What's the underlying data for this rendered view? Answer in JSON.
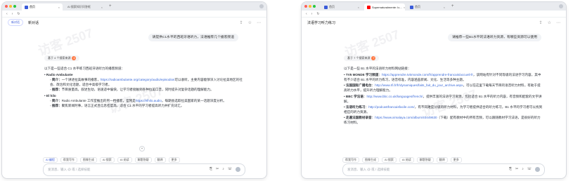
{
  "left": {
    "tabs": [
      {
        "label": "首页",
        "active": true
      },
      {
        "label": "AI 搜索知识问答框",
        "active": false
      }
    ],
    "header": {
      "new_chat": "新对话",
      "title": "新对话"
    },
    "user_message": "请提供C1水平的西班牙语听力，法语推荐几个播客频道",
    "ref_pill": {
      "label": "基于 4 个搜索来源",
      "count": "4"
    },
    "intro": "以下是一些适合 C1 水平练习西班牙语听力的播客频道：",
    "items": [
      {
        "title": "Radio Ambulante",
        "intro_label": "简介：",
        "intro_text": "一个讲述拉美故事的播客，",
        "link": "https://radioambulante.org/category/audio/episodios",
        "intro_rest": "可以收听。主要内容能够深入讨论拉美地区的社会、政治和文化话题，适合中高级学习者。",
        "reason_label": "推荐：",
        "reason_text": "节目质量高，叙述生动，语速适中偏快，让学习者接触到各种拉美口音，同时提升对复杂话题的理解能力。"
      },
      {
        "title": "El hilo",
        "intro_label": "简介：",
        "intro_text": "Radio Ambulante 工作室推出的另一档播客，官网是",
        "link": "https://elhilo.audio",
        "intro_rest": "，每期会选取拉美国家的某一话题深度分析。",
        "reason_label": "推荐：",
        "reason_text": "聚焦新闻时事，语言正式且信息密度高，适合 C1 水平的学习者提高听力并扩充词汇。"
      }
    ],
    "toolbar": [
      "AI 编程",
      "帮我写作",
      "图像生成",
      "AI 搜索",
      "AI 阅读",
      "解题答疑",
      "翻译",
      "更多"
    ],
    "input_placeholder": "发消息、输入 @ 或 / 选择技能"
  },
  "right": {
    "tabs": [
      {
        "label": "首页",
        "active": false
      },
      {
        "label": "Supernaturalmente: Ic...",
        "active": true
      },
      {
        "label": "首页",
        "active": false
      }
    ],
    "header": {
      "title": "法语学习听力练习"
    },
    "user_message": "请推荐一些B1水平的法语听力资源，有哪些资源可以使用",
    "ref_pill": {
      "label": "基于 7 个搜索来源",
      "count": "7"
    },
    "intro": "以下是一些 B1 水平的法语听力材料网站链接：",
    "items": [
      {
        "title": "TV5 MONDE 学习频道",
        "link": "https://apprendre.tv5monde.com/fr/apprendre-francais/accueil-fr",
        "text": "该网站有针对不同等级的法语学习内容，其中有不少适合 B1 水平的听力练习，语音标准，内容涵盖新闻、文化、生活等多种主题。"
      },
      {
        "title": "法国国际广播电台",
        "link": "http://www.rfi.fr/fr/dynamiques/faits_fait_du_jour_archive.aspx",
        "text": "可以在这里下载每天节目的语音听力材料，有助于提高听力水平，提升听力理解能力。"
      },
      {
        "title": "BBC 学法语",
        "link": "http://www.bbc.co.uk/languages/french/",
        "text": "提供丰富的法语学习资源，包括适合 B1 水平的听力内容，有音频和配套的文字讲解。"
      },
      {
        "title": "法语听力练习",
        "link": "http://podcastfrancaisfacile.com/",
        "text": "有不同难度分级的听力材料，为学习者提供适合的听力练习，B1 水平的学习者可以找到相应的听力资源。"
      },
      {
        "title": "走遍法国教材录音",
        "link": "https://www.ximalaya.com/album/40449630",
        "text": "（下载）配有教材中的所有音频，可以跟随教材学习法语，是很好的听力练习材料。"
      }
    ],
    "toolbar": [
      "帮我写作",
      "图像生成",
      "AI 搜索",
      "AI 阅读",
      "解题答疑",
      "翻译",
      "更多"
    ],
    "input_placeholder": "发消息、输入 @ 或 / 选择技能"
  },
  "watermark": "访客 2507"
}
